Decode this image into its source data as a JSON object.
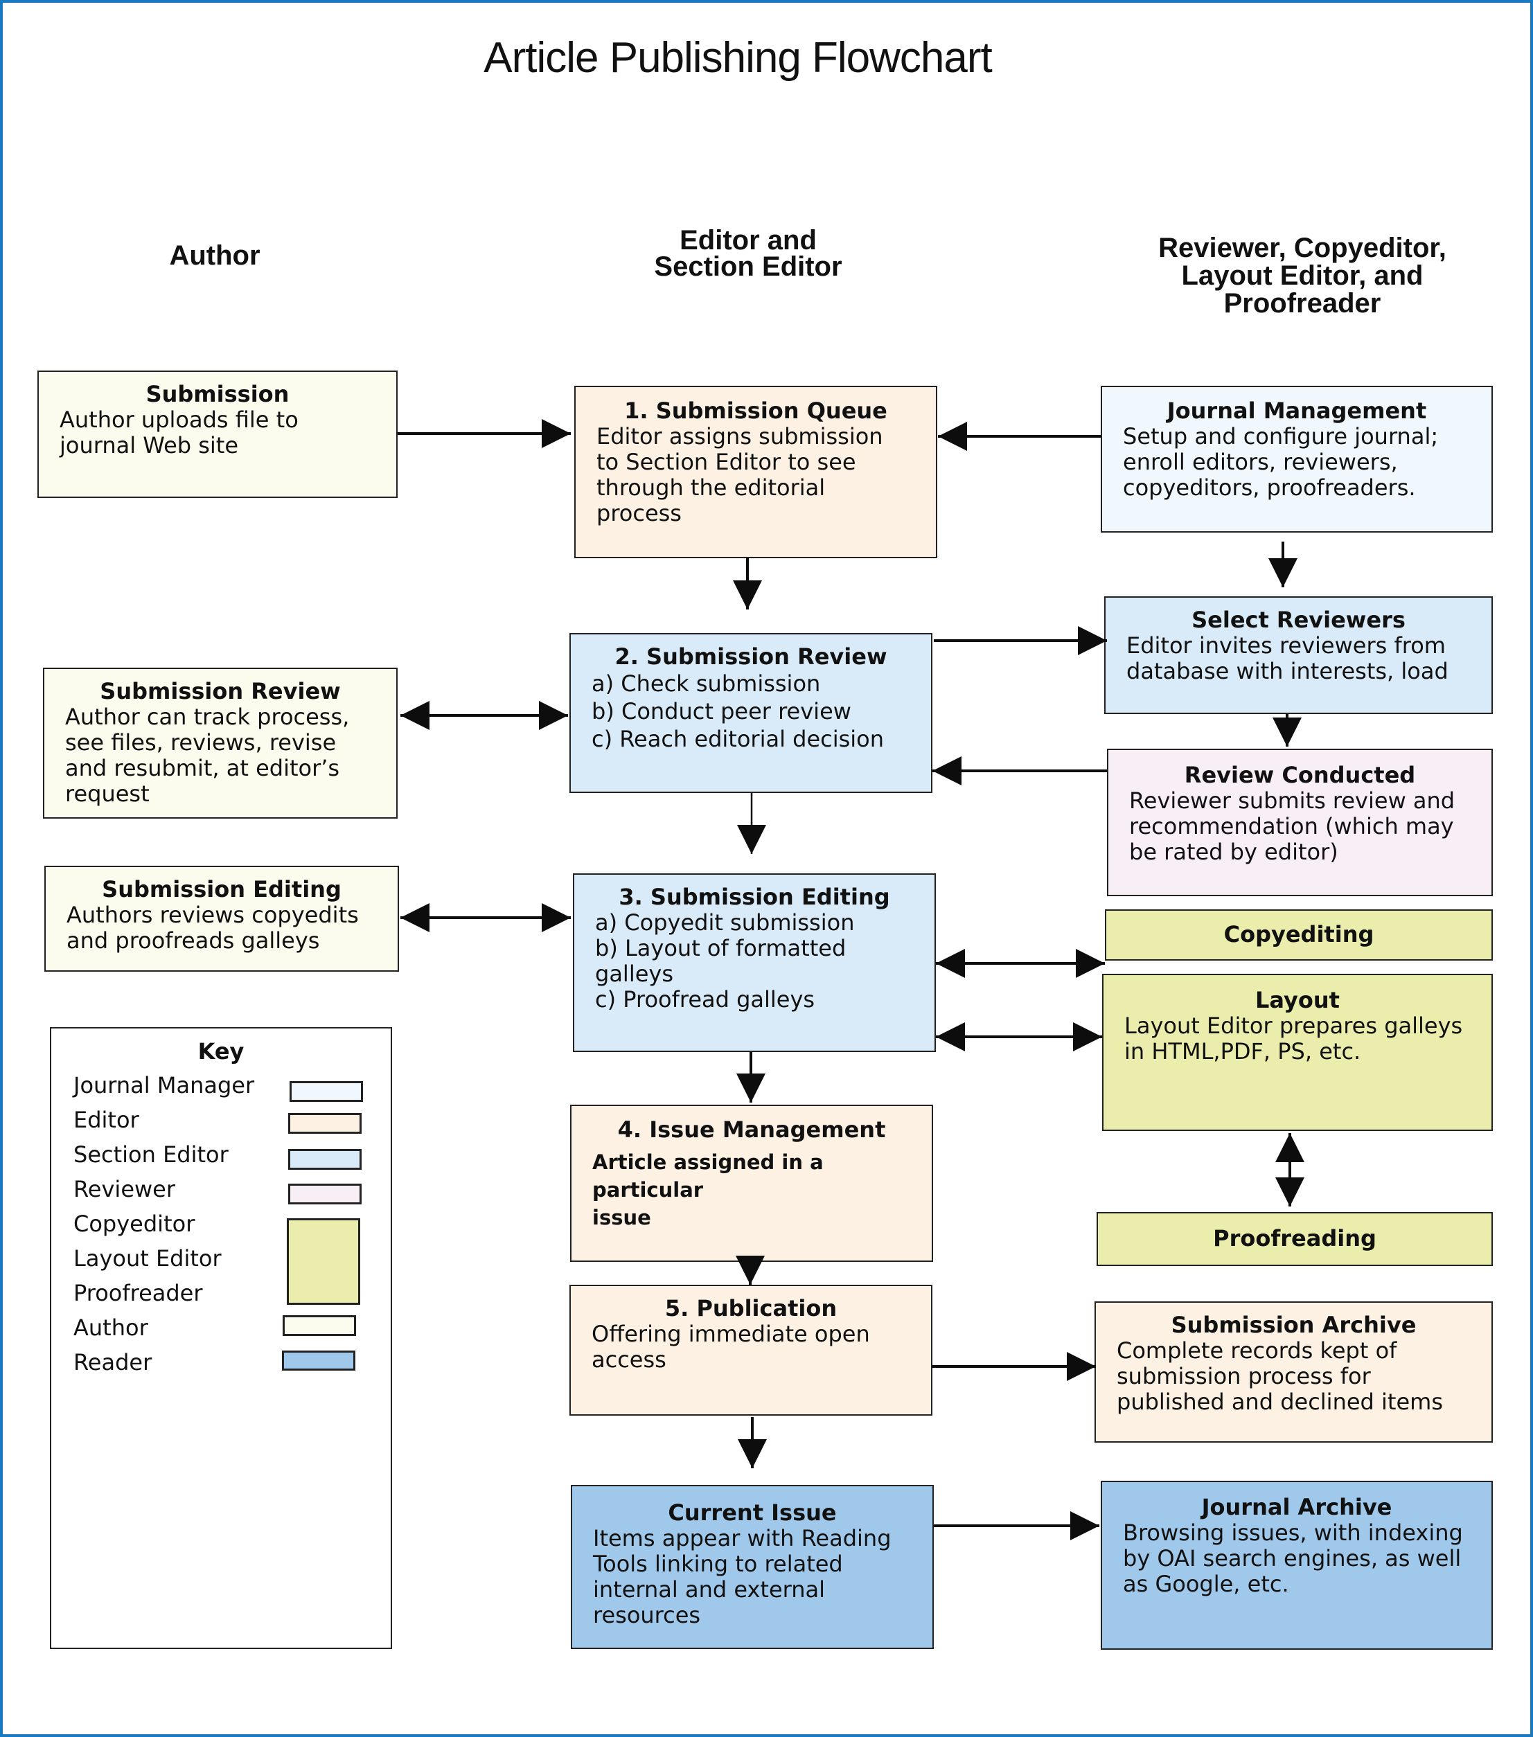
{
  "title": "Article Publishing Flowchart",
  "columns": {
    "author": "Author",
    "editor": "Editor and\nSection Editor",
    "reviewer": "Reviewer, Copyeditor,\nLayout Editor, and\nProofreader"
  },
  "colors": {
    "frame": "#1a7abf",
    "journal_manager": "#f0f8fd",
    "editor": "#fcf1e2",
    "section_editor": "#d9eaf8",
    "reviewer": "#f8eef6",
    "copyeditor_layout_proofreader": "#ebedac",
    "author": "#fcfcee",
    "reader": "#9fc8ea"
  },
  "boxes": {
    "author_submission": {
      "title": "Submission",
      "body": "Author uploads file to\njournal Web site"
    },
    "author_review": {
      "title": "Submission Review",
      "body": "Author can track process,\nsee files, reviews, revise\nand resubmit, at editor’s\nrequest"
    },
    "author_editing": {
      "title": "Submission Editing",
      "body": "Authors reviews copyedits\nand proofreads galleys"
    },
    "queue": {
      "title": "1. Submission Queue",
      "body": "Editor assigns submission\nto Section Editor to see\nthrough the editorial\nprocess"
    },
    "review": {
      "title": "2. Submission Review",
      "body": "a) Check submission\nb) Conduct peer review\nc) Reach editorial decision"
    },
    "editing": {
      "title": "3. Submission Editing",
      "body": "a) Copyedit submission\nb) Layout of formatted\ngalleys\nc) Proofread galleys"
    },
    "issue": {
      "title": "4. Issue Management",
      "body": "Article assigned in a particular\nissue"
    },
    "publication": {
      "title": "5. Publication",
      "body": "Offering immediate open\naccess"
    },
    "current_issue": {
      "title": "Current Issue",
      "body": "Items appear with Reading\nTools linking to related\ninternal and external\nresources"
    },
    "journal_management": {
      "title": "Journal Management",
      "body": "Setup and configure journal;\nenroll editors, reviewers,\ncopyeditors, proofreaders."
    },
    "select_reviewers": {
      "title": "Select Reviewers",
      "body": "Editor invites reviewers from\ndatabase with interests, load"
    },
    "review_conducted": {
      "title": "Review Conducted",
      "body": "Reviewer submits review and\nrecommendation (which may\nbe rated by editor)"
    },
    "copyediting": {
      "title": "Copyediting",
      "body": ""
    },
    "layout": {
      "title": "Layout",
      "body": "Layout Editor prepares galleys\nin HTML,PDF, PS, etc."
    },
    "proofreading": {
      "title": "Proofreading",
      "body": ""
    },
    "submission_archive": {
      "title": "Submission Archive",
      "body": "Complete records kept of\nsubmission process for\npublished and declined items"
    },
    "journal_archive": {
      "title": "Journal Archive",
      "body": "Browsing issues, with indexing\nby OAI search engines, as well\nas Google, etc."
    }
  },
  "key": {
    "title": "Key",
    "items": [
      {
        "label": "Journal Manager"
      },
      {
        "label": "Editor"
      },
      {
        "label": "Section Editor"
      },
      {
        "label": "Reviewer"
      },
      {
        "label": "Copyeditor"
      },
      {
        "label": "Layout Editor"
      },
      {
        "label": "Proofreader"
      },
      {
        "label": "Author"
      },
      {
        "label": "Reader"
      }
    ]
  }
}
